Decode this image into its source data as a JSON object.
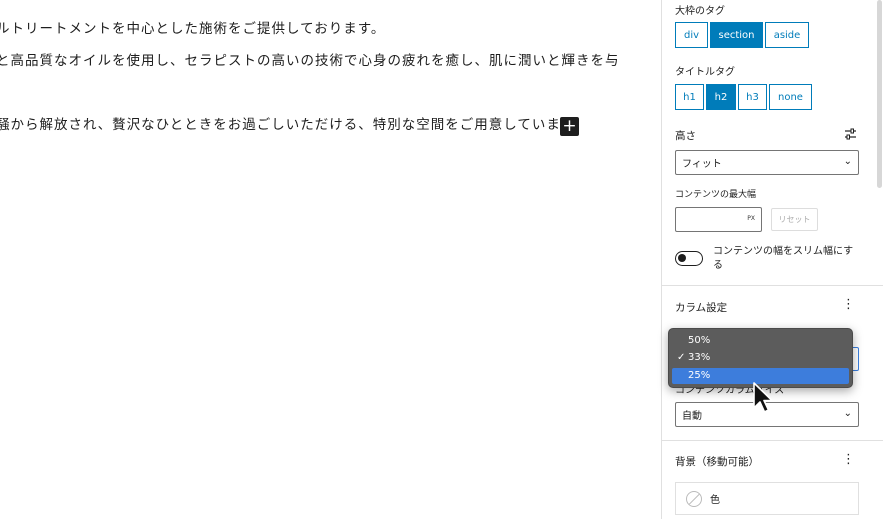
{
  "editor": {
    "paragraphs": [
      "ルトリートメントを中心とした施術をご提供しております。",
      "と高品質なオイルを使用し、セラピストの高いの技術で心身の疲れを癒し、肌に潤いと輝きを与",
      "騒から解放され、贅沢なひとときをお過ごしいただける、特別な空間をご用意しています。"
    ],
    "add_block_label": "+"
  },
  "sidebar": {
    "outer_tag": {
      "label": "大枠のタグ",
      "options": [
        "div",
        "section",
        "aside"
      ],
      "selected": "section"
    },
    "title_tag": {
      "label": "タイトルタグ",
      "options": [
        "h1",
        "h2",
        "h3",
        "none"
      ],
      "selected": "h2"
    },
    "height": {
      "label": "高さ",
      "value": "フィット"
    },
    "max_width": {
      "label": "コンテンツの最大幅",
      "value": "",
      "unit": "PX",
      "reset_label": "リセット"
    },
    "slim_toggle": {
      "label": "コンテンツの幅をスリム幅にする",
      "on": false
    },
    "column_settings": {
      "title": "カラム設定",
      "hidden_label": "コンテンツカラムサイズ",
      "size_value": "自動"
    },
    "background": {
      "title": "背景（移動可能）",
      "color_label": "色"
    }
  },
  "dropdown": {
    "options": [
      "50%",
      "33%",
      "25%"
    ],
    "checked": "33%",
    "highlighted": "25%"
  },
  "colors": {
    "accent": "#007cba",
    "highlight": "#3d7ddc",
    "menu_bg": "#5c5c5c"
  }
}
